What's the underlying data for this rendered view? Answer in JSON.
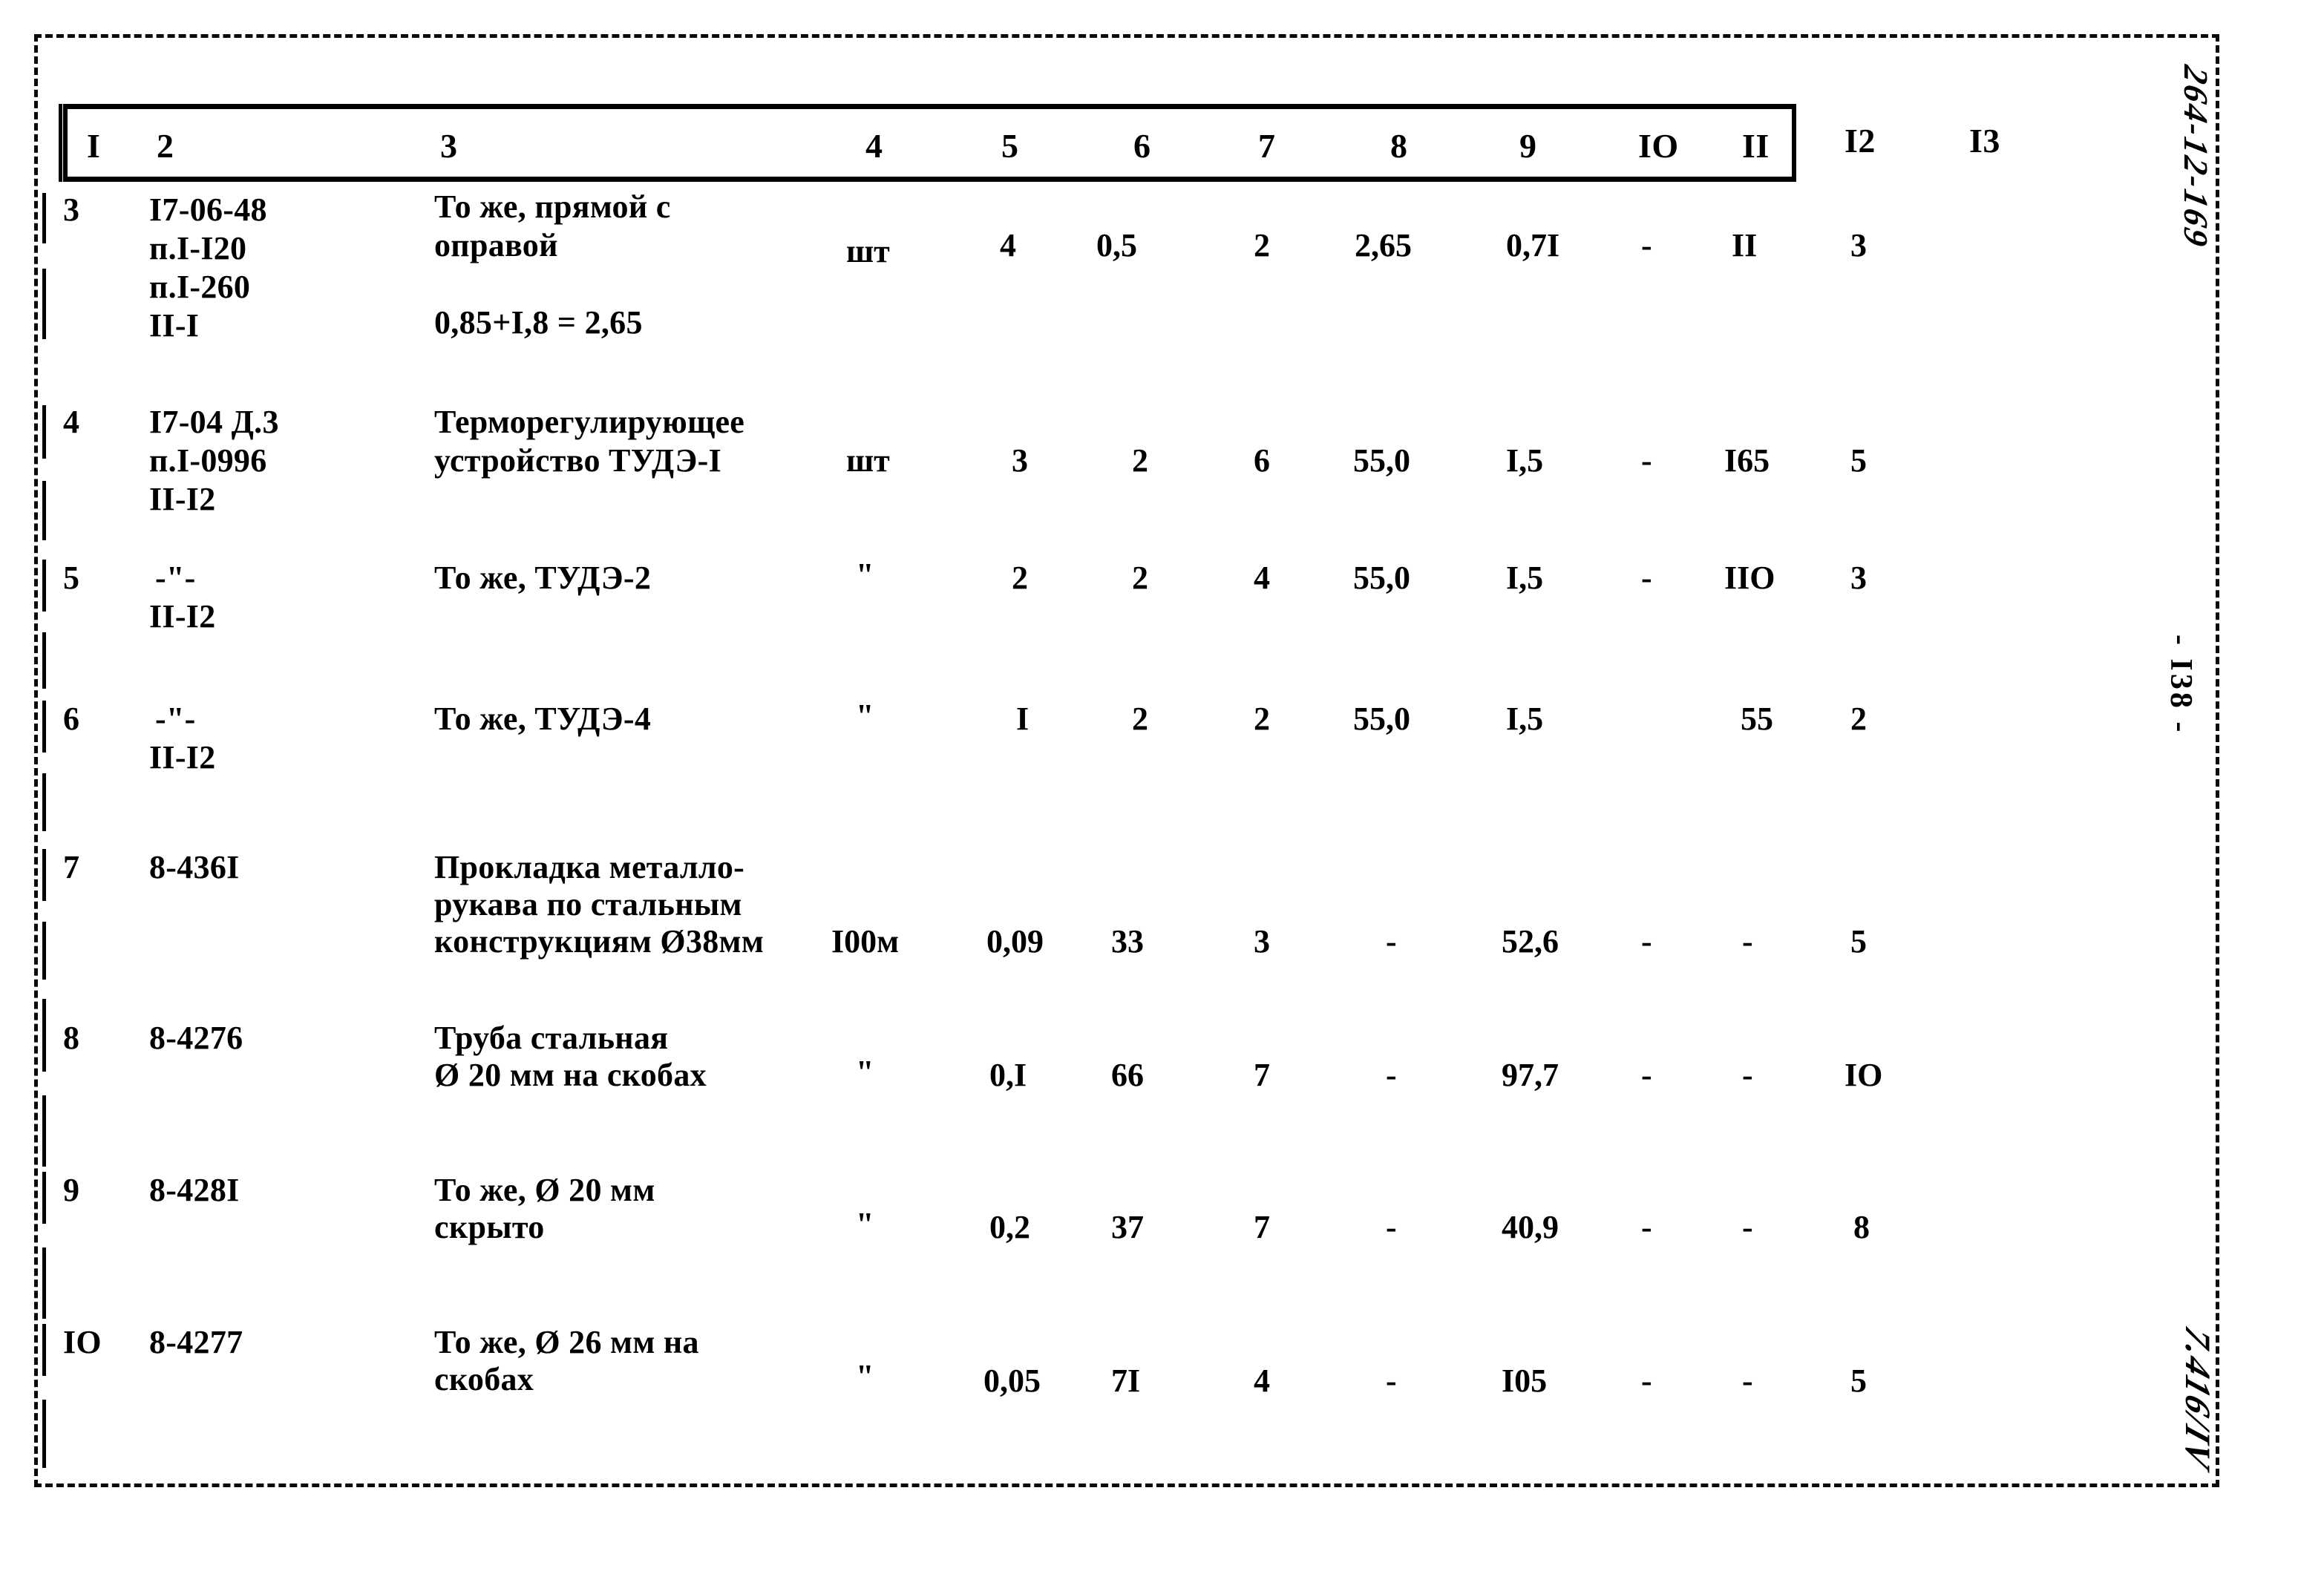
{
  "document": {
    "code": "264-12-169",
    "page_label": "- I38 -",
    "hand_note": "7.416/IV"
  },
  "table": {
    "column_headers": [
      "I",
      "2",
      "3",
      "4",
      "5",
      "6",
      "7",
      "8",
      "9",
      "IO",
      "II",
      "I2",
      "I3"
    ],
    "rows": [
      {
        "num": "3",
        "code_lines": [
          "I7-06-48",
          "п.I-I20",
          "п.I-260",
          "II-I"
        ],
        "desc_lines": [
          "То же, прямой с",
          "оправой"
        ],
        "desc_extra": "0,85+I,8 = 2,65",
        "unit": "шт",
        "c5": "4",
        "c6": "0,5",
        "c7": "2",
        "c8": "2,65",
        "c9": "0,7I",
        "c10": "-",
        "c11": "II",
        "c12": "3",
        "c13": ""
      },
      {
        "num": "4",
        "code_lines": [
          "I7-04 Д.3",
          "п.I-0996",
          "II-I2"
        ],
        "desc_lines": [
          "Терморегулирующее",
          "устройство ТУДЭ-I"
        ],
        "desc_extra": "",
        "unit": "шт",
        "c5": "3",
        "c6": "2",
        "c7": "6",
        "c8": "55,0",
        "c9": "I,5",
        "c10": "-",
        "c11": "I65",
        "c12": "5",
        "c13": ""
      },
      {
        "num": "5",
        "code_lines": [
          "-\"-",
          "II-I2"
        ],
        "desc_lines": [
          "То же, ТУДЭ-2"
        ],
        "desc_extra": "",
        "unit": "\"",
        "c5": "2",
        "c6": "2",
        "c7": "4",
        "c8": "55,0",
        "c9": "I,5",
        "c10": "-",
        "c11": "IIO",
        "c12": "3",
        "c13": ""
      },
      {
        "num": "6",
        "code_lines": [
          "-\"-",
          "II-I2"
        ],
        "desc_lines": [
          "То же, ТУДЭ-4"
        ],
        "desc_extra": "",
        "unit": "\"",
        "c5": "I",
        "c6": "2",
        "c7": "2",
        "c8": "55,0",
        "c9": "I,5",
        "c10": "",
        "c11": "55",
        "c12": "2",
        "c13": ""
      },
      {
        "num": "7",
        "code_lines": [
          "8-436I"
        ],
        "desc_lines": [
          "Прокладка металло-",
          "рукава по стальным",
          "конструкциям Ø38мм"
        ],
        "desc_extra": "",
        "unit": "I00м",
        "c5": "0,09",
        "c6": "33",
        "c7": "3",
        "c8": "-",
        "c9": "52,6",
        "c10": "-",
        "c11": "-",
        "c12": "5",
        "c13": ""
      },
      {
        "num": "8",
        "code_lines": [
          "8-4276"
        ],
        "desc_lines": [
          "Труба стальная",
          "Ø 20 мм на скобах"
        ],
        "desc_extra": "",
        "unit": "\"",
        "c5": "0,I",
        "c6": "66",
        "c7": "7",
        "c8": "-",
        "c9": "97,7",
        "c10": "-",
        "c11": "-",
        "c12": "IO",
        "c13": ""
      },
      {
        "num": "9",
        "code_lines": [
          "8-428I"
        ],
        "desc_lines": [
          "То же, Ø 20 мм",
          "скрыто"
        ],
        "desc_extra": "",
        "unit": "\"",
        "c5": "0,2",
        "c6": "37",
        "c7": "7",
        "c8": "-",
        "c9": "40,9",
        "c10": "-",
        "c11": "-",
        "c12": "8",
        "c13": ""
      },
      {
        "num": "IO",
        "code_lines": [
          "8-4277"
        ],
        "desc_lines": [
          "То же, Ø 26 мм на",
          "скобах"
        ],
        "desc_extra": "",
        "unit": "\"",
        "c5": "0,05",
        "c6": "7I",
        "c7": "4",
        "c8": "-",
        "c9": "I05",
        "c10": "-",
        "c11": "-",
        "c12": "5",
        "c13": ""
      }
    ]
  }
}
